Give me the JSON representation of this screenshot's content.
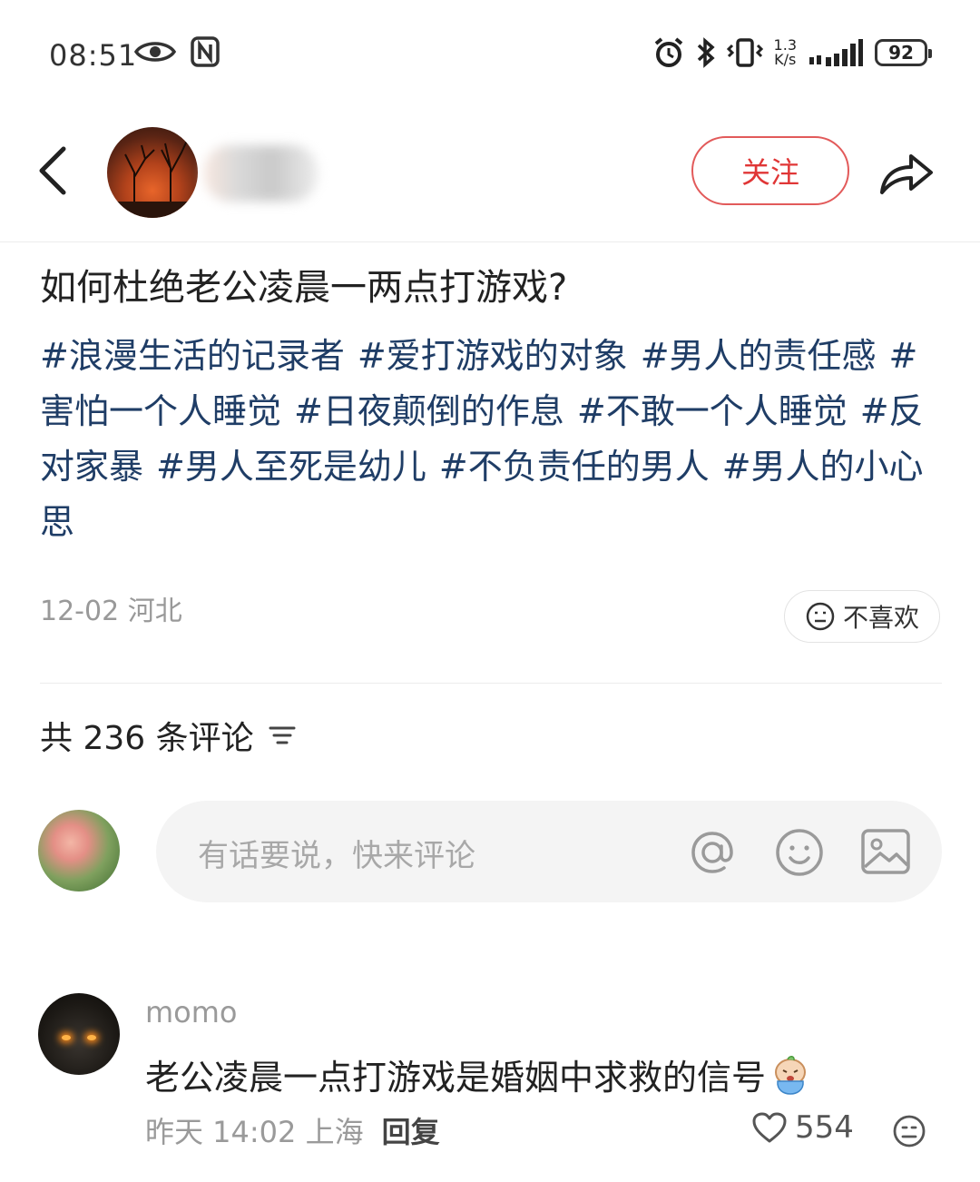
{
  "status_bar": {
    "time": "08:51",
    "net_speed_top": "1.3",
    "net_speed_bottom": "K/s",
    "battery": "92"
  },
  "header": {
    "follow_label": "关注"
  },
  "post": {
    "title": "如何杜绝老公凌晨一两点打游戏?",
    "tags": [
      "#浪漫生活的记录者",
      "#爱打游戏的对象",
      "#男人的责任感",
      "#害怕一个人睡觉",
      "#日夜颠倒的作息",
      "#不敢一个人睡觉",
      "#反对家暴",
      "#男人至死是幼儿",
      "#不负责任的男人",
      "#男人的小心思"
    ],
    "date_location": "12-02 河北",
    "dislike_label": "不喜欢"
  },
  "comments": {
    "count_label": "共 236 条评论",
    "input_placeholder": "有话要说，快来评论",
    "items": [
      {
        "user": "momo",
        "text": "老公凌晨一点打游戏是婚姻中求救的信号",
        "time_location": "昨天 14:02 上海",
        "reply_label": "回复",
        "likes": "554"
      }
    ]
  },
  "colors": {
    "accent_red": "#e03636",
    "tag_blue": "#1f3d66",
    "muted_gray": "#999999"
  }
}
